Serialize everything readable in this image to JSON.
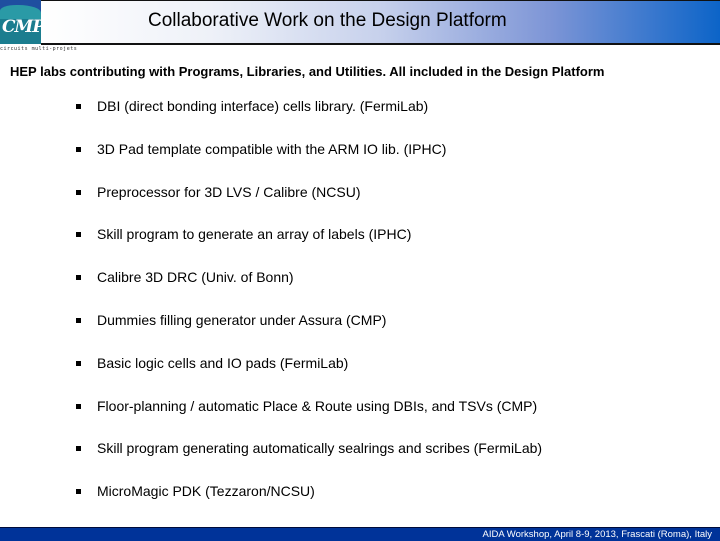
{
  "header": {
    "title": "Collaborative Work on the Design Platform",
    "logo_text": "CMP",
    "logo_caption": "circuits multi-projets"
  },
  "subtitle": "HEP labs contributing with Programs, Libraries, and Utilities.   All included in the Design Platform",
  "items": [
    {
      "label": "DBI (direct bonding interface) cells library. (FermiLab)"
    },
    {
      "label": "3D Pad template compatible with the ARM IO lib. (IPHC)"
    },
    {
      "label": "Preprocessor for 3D LVS / Calibre (NCSU)"
    },
    {
      "label": "Skill program to generate an array of labels (IPHC)"
    },
    {
      "label": "Calibre 3D DRC (Univ. of Bonn)"
    },
    {
      "label": "Dummies filling generator under Assura (CMP)"
    },
    {
      "label": "Basic logic cells and IO pads (FermiLab)"
    },
    {
      "label": "Floor-planning / automatic Place & Route using DBIs, and TSVs (CMP)"
    },
    {
      "label": "Skill program generating automatically sealrings and scribes (FermiLab)"
    },
    {
      "label": "MicroMagic PDK (Tezzaron/NCSU)"
    }
  ],
  "footer": {
    "text": "AIDA Workshop, April 8-9, 2013, Frascati (Roma), Italy"
  },
  "colors": {
    "footer_bg": "#003399",
    "header_gradient_end": "#0c64c8",
    "logo_teal": "#1b7d8f"
  }
}
